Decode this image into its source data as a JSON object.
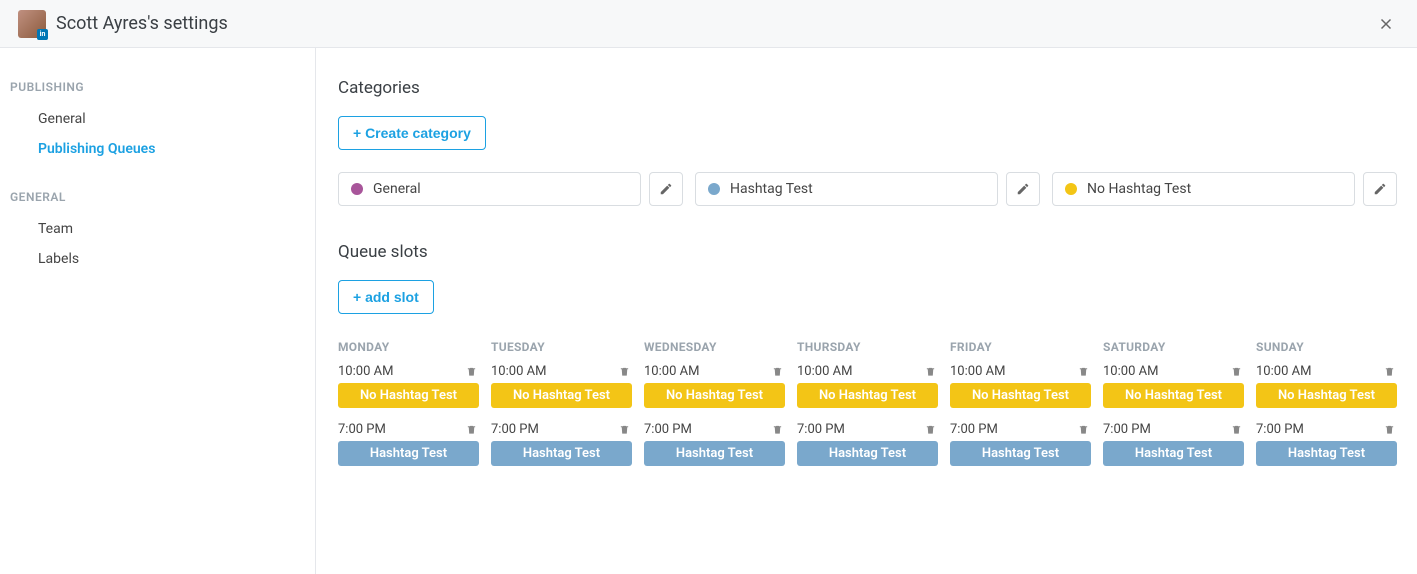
{
  "header": {
    "title": "Scott Ayres's settings",
    "avatar_badge": "in"
  },
  "sidebar": {
    "sections": [
      {
        "title": "PUBLISHING",
        "items": [
          {
            "label": "General",
            "active": false
          },
          {
            "label": "Publishing Queues",
            "active": true
          }
        ]
      },
      {
        "title": "GENERAL",
        "items": [
          {
            "label": "Team",
            "active": false
          },
          {
            "label": "Labels",
            "active": false
          }
        ]
      }
    ]
  },
  "main": {
    "categories_title": "Categories",
    "create_category_label": "+ Create category",
    "categories": [
      {
        "name": "General",
        "color": "#a8559a"
      },
      {
        "name": "Hashtag Test",
        "color": "#7aa8cc"
      },
      {
        "name": "No Hashtag Test",
        "color": "#f3c516"
      }
    ],
    "queue_title": "Queue slots",
    "add_slot_label": "+ add slot",
    "days": [
      {
        "name": "MONDAY"
      },
      {
        "name": "TUESDAY"
      },
      {
        "name": "WEDNESDAY"
      },
      {
        "name": "THURSDAY"
      },
      {
        "name": "FRIDAY"
      },
      {
        "name": "SATURDAY"
      },
      {
        "name": "SUNDAY"
      }
    ],
    "slot_rows": [
      {
        "time": "10:00 AM",
        "tag": "No Hashtag Test",
        "color": "#f3c516"
      },
      {
        "time": "7:00 PM",
        "tag": "Hashtag Test",
        "color": "#7aa8cc"
      }
    ]
  }
}
